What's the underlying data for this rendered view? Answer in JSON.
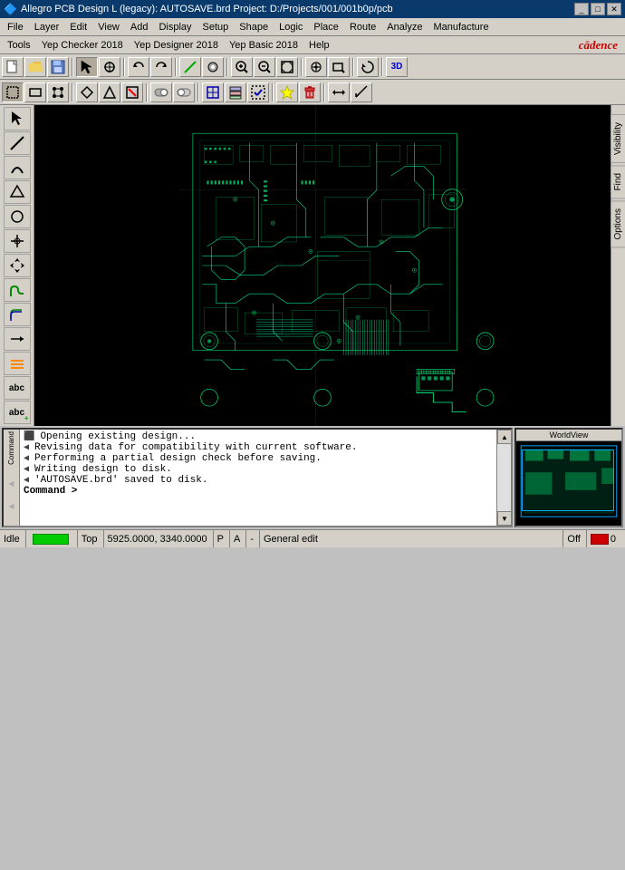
{
  "titlebar": {
    "title": "Allegro PCB Design L (legacy): AUTOSAVE.brd  Project: D:/Projects/001/001b0p/pcb",
    "icon": "allegro-icon",
    "controls": {
      "minimize": "_",
      "restore": "□",
      "close": "✕"
    }
  },
  "menubar1": {
    "items": [
      "File",
      "Layer",
      "Edit",
      "View",
      "Add",
      "Display",
      "Setup",
      "Shape",
      "Logic",
      "Place",
      "Route",
      "Analyze",
      "Manufacture"
    ]
  },
  "menubar2": {
    "items": [
      "Tools",
      "Yep Checker 2018",
      "Yep Designer 2018",
      "Yep Basic 2018",
      "Help"
    ],
    "logo": "cādence"
  },
  "toolbar1": {
    "buttons": [
      "new",
      "open",
      "save",
      "sep",
      "pointer",
      "snap",
      "sep",
      "undo",
      "redo",
      "sep",
      "add-connect",
      "add-via",
      "sep",
      "zoom-in",
      "zoom-out",
      "zoom-fit",
      "sep",
      "redraw",
      "sep",
      "3d"
    ]
  },
  "toolbar2": {
    "buttons": [
      "select",
      "select-box",
      "select-lasso",
      "sep",
      "move",
      "copy",
      "delete",
      "sep",
      "mirror",
      "rotate",
      "sep",
      "properties",
      "sep",
      "check"
    ]
  },
  "left_panel": {
    "buttons": [
      "select",
      "add-line",
      "add-arc",
      "add-circle",
      "add-text",
      "move",
      "copy",
      "delete",
      "stretch",
      "show-hide",
      "label",
      "place-pin",
      "add-component",
      "route-single",
      "route-diff",
      "slide",
      "unroute",
      "add-ratsnest",
      "highlight",
      "dehighlight",
      "measure",
      "set-color"
    ]
  },
  "right_tabs": {
    "tabs": [
      "Visibility",
      "Find",
      "Options"
    ]
  },
  "console": {
    "label_top": "Command",
    "messages": [
      "Opening existing design...",
      "Revising data for compatibility with current software.",
      "Performing a partial design check before saving.",
      "Writing design to disk.",
      "'AUTOSAVE.brd' saved to disk.",
      "Command >"
    ]
  },
  "minimap": {
    "label": "WorldView"
  },
  "statusbar": {
    "state": "Idle",
    "indicator_color": "#00cc00",
    "view": "Top",
    "coordinates": "5925.0000, 3340.0000",
    "pa": "P",
    "a": "A",
    "dash": "-",
    "mode": "General edit",
    "off_label": "Off",
    "err_count": "0"
  }
}
